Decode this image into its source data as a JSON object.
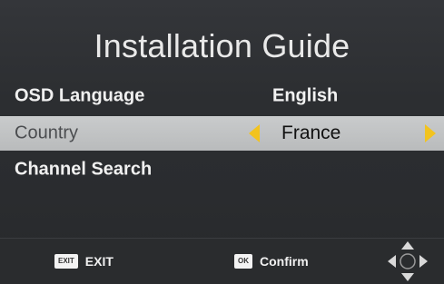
{
  "title": "Installation Guide",
  "menu": {
    "items": [
      {
        "label": "OSD Language",
        "value": "English"
      },
      {
        "label": "Country",
        "value": "France"
      },
      {
        "label": "Channel Search"
      }
    ]
  },
  "footer": {
    "exit": {
      "key": "EXIT",
      "label": "EXIT"
    },
    "confirm": {
      "key": "OK",
      "label": "Confirm"
    },
    "nav_icon": "dpad-arrows-icon"
  },
  "colors": {
    "accent_arrow": "#f2c31f",
    "selected_row": "#c2c4c5",
    "background": "#2a2c2f"
  }
}
